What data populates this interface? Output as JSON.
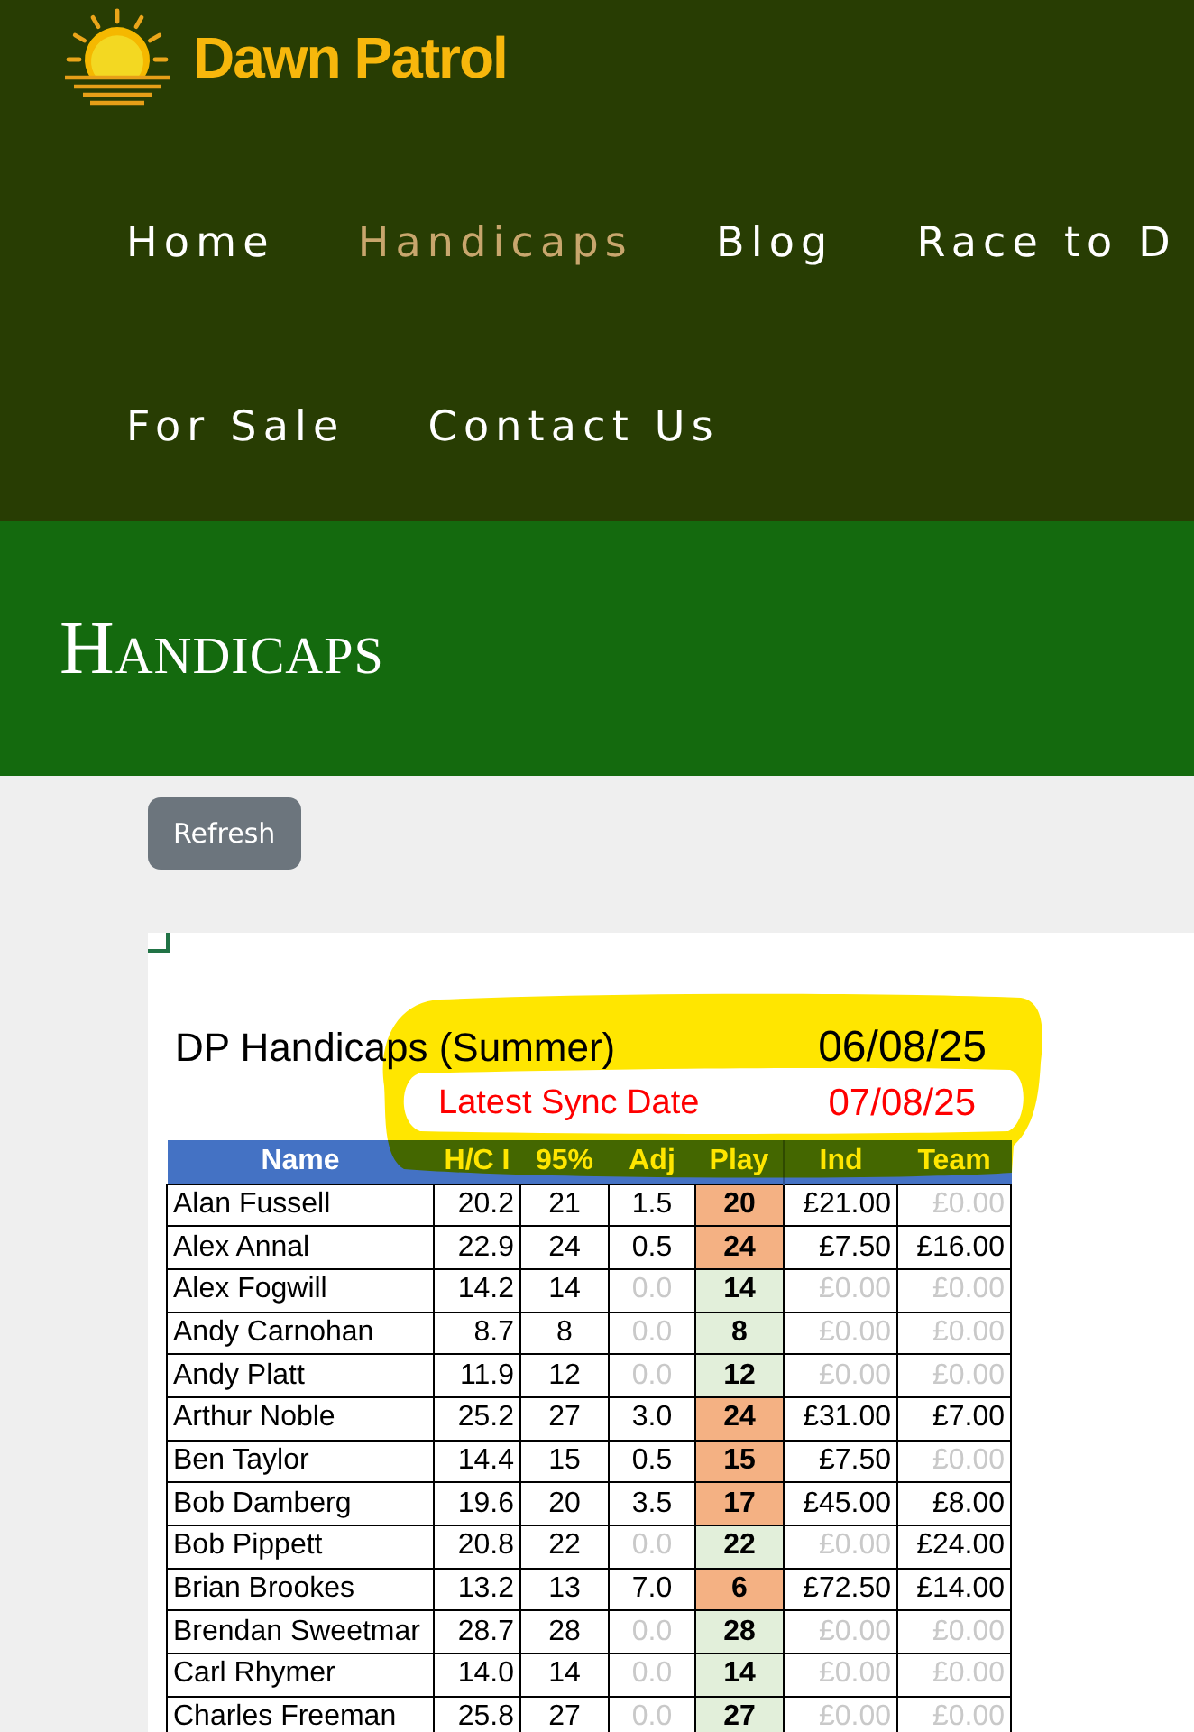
{
  "site": {
    "logo_text": "Dawn Patrol"
  },
  "nav": {
    "items": [
      {
        "label": "Home",
        "selected": false
      },
      {
        "label": "Handicaps",
        "selected": true
      },
      {
        "label": "Blog",
        "selected": false
      },
      {
        "label": "Race to D",
        "selected": false
      },
      {
        "label": "For Sale",
        "selected": false
      },
      {
        "label": "Contact Us",
        "selected": false
      }
    ]
  },
  "page_title": "Handicaps",
  "refresh_button": "Refresh",
  "sheet": {
    "title": "DP Handicaps (Summer)",
    "date": "06/08/25",
    "sync_label": "Latest Sync Date",
    "sync_date": "07/08/25",
    "columns": [
      "Name",
      "H/C I",
      "95%",
      "Adj",
      "Play",
      "Ind",
      "Team"
    ],
    "rows": [
      {
        "name": "Alan Fussell",
        "hci": "20.2",
        "p95": "21",
        "adj": "1.5",
        "play": "20",
        "ind": "£21.00",
        "team": "£0.00",
        "adjusted": true,
        "ind_dim": false,
        "team_dim": true
      },
      {
        "name": "Alex Annal",
        "hci": "22.9",
        "p95": "24",
        "adj": "0.5",
        "play": "24",
        "ind": "£7.50",
        "team": "£16.00",
        "adjusted": true,
        "ind_dim": false,
        "team_dim": false
      },
      {
        "name": "Alex Fogwill",
        "hci": "14.2",
        "p95": "14",
        "adj": "0.0",
        "play": "14",
        "ind": "£0.00",
        "team": "£0.00",
        "adjusted": false,
        "ind_dim": true,
        "team_dim": true
      },
      {
        "name": "Andy Carnohan",
        "hci": "8.7",
        "p95": "8",
        "adj": "0.0",
        "play": "8",
        "ind": "£0.00",
        "team": "£0.00",
        "adjusted": false,
        "ind_dim": true,
        "team_dim": true
      },
      {
        "name": "Andy Platt",
        "hci": "11.9",
        "p95": "12",
        "adj": "0.0",
        "play": "12",
        "ind": "£0.00",
        "team": "£0.00",
        "adjusted": false,
        "ind_dim": true,
        "team_dim": true
      },
      {
        "name": "Arthur Noble",
        "hci": "25.2",
        "p95": "27",
        "adj": "3.0",
        "play": "24",
        "ind": "£31.00",
        "team": "£7.00",
        "adjusted": true,
        "ind_dim": false,
        "team_dim": false
      },
      {
        "name": "Ben Taylor",
        "hci": "14.4",
        "p95": "15",
        "adj": "0.5",
        "play": "15",
        "ind": "£7.50",
        "team": "£0.00",
        "adjusted": true,
        "ind_dim": false,
        "team_dim": true
      },
      {
        "name": "Bob Damberg",
        "hci": "19.6",
        "p95": "20",
        "adj": "3.5",
        "play": "17",
        "ind": "£45.00",
        "team": "£8.00",
        "adjusted": true,
        "ind_dim": false,
        "team_dim": false
      },
      {
        "name": "Bob Pippett",
        "hci": "20.8",
        "p95": "22",
        "adj": "0.0",
        "play": "22",
        "ind": "£0.00",
        "team": "£24.00",
        "adjusted": false,
        "ind_dim": true,
        "team_dim": false
      },
      {
        "name": "Brian Brookes",
        "hci": "13.2",
        "p95": "13",
        "adj": "7.0",
        "play": "6",
        "ind": "£72.50",
        "team": "£14.00",
        "adjusted": true,
        "ind_dim": false,
        "team_dim": false
      },
      {
        "name": "Brendan Sweetmar",
        "hci": "28.7",
        "p95": "28",
        "adj": "0.0",
        "play": "28",
        "ind": "£0.00",
        "team": "£0.00",
        "adjusted": false,
        "ind_dim": true,
        "team_dim": true
      },
      {
        "name": "Carl Rhymer",
        "hci": "14.0",
        "p95": "14",
        "adj": "0.0",
        "play": "14",
        "ind": "£0.00",
        "team": "£0.00",
        "adjusted": false,
        "ind_dim": true,
        "team_dim": true
      },
      {
        "name": "Charles Freeman",
        "hci": "25.8",
        "p95": "27",
        "adj": "0.0",
        "play": "27",
        "ind": "£0.00",
        "team": "£0.00",
        "adjusted": false,
        "ind_dim": true,
        "team_dim": true
      }
    ]
  }
}
